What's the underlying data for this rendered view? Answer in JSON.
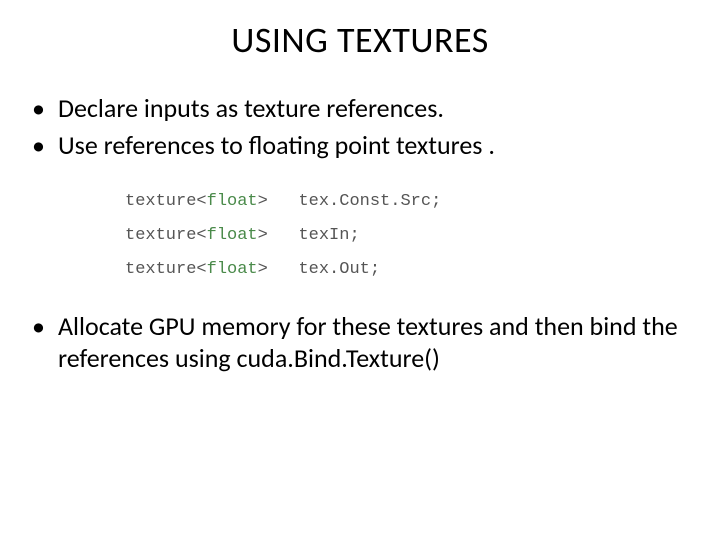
{
  "title": "USING TEXTURES",
  "bullets_top": [
    "Declare inputs as texture references.",
    "Use references to floating point textures ."
  ],
  "code": {
    "lines": [
      {
        "prefix": "texture<",
        "type": "float",
        "suffix": ">   tex.Const.Src;"
      },
      {
        "prefix": "texture<",
        "type": "float",
        "suffix": ">   texIn;"
      },
      {
        "prefix": "texture<",
        "type": "float",
        "suffix": ">   tex.Out;"
      }
    ]
  },
  "bullets_bottom": [
    "Allocate GPU memory for these textures and then bind the references using cuda.Bind.Texture()"
  ]
}
